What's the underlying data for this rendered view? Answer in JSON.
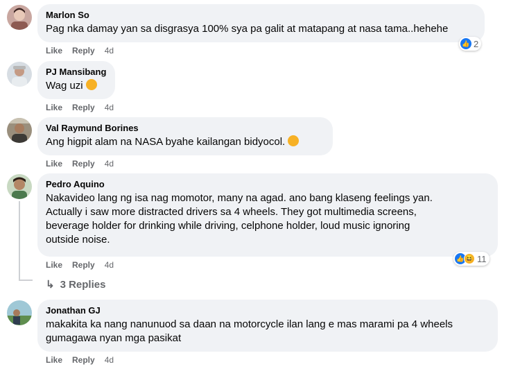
{
  "comments": [
    {
      "author": "Marlon So",
      "text": "Pag nka damay yan sa disgrasya 100% sya pa galit at matapang at nasa tama..hehehe",
      "like": "Like",
      "reply": "Reply",
      "time": "4d",
      "reaction_count": "2"
    },
    {
      "author": "PJ Mansibang",
      "text": "Wag uzi",
      "like": "Like",
      "reply": "Reply",
      "time": "4d"
    },
    {
      "author": "Val Raymund Borines",
      "text": "Ang higpit alam na NASA byahe kailangan bidyocol.",
      "like": "Like",
      "reply": "Reply",
      "time": "4d"
    },
    {
      "author": "Pedro Aquino",
      "lines": [
        "Nakavideo lang ng isa nag momotor, many na agad. ano bang klaseng feelings yan.",
        "Actually i saw more distracted drivers sa 4 wheels. They got multimedia screens,",
        "beverage holder for drinking while driving, celphone holder, loud music ignoring",
        "outside noise."
      ],
      "like": "Like",
      "reply": "Reply",
      "time": "4d",
      "reaction_count": "11",
      "replies_label": "3 Replies"
    },
    {
      "author": "Jonathan GJ",
      "lines": [
        "makakita ka nang nanunuod sa daan na motorcycle ilan lang e mas marami pa 4 wheels",
        "gumagawa nyan mga pasikat"
      ],
      "like": "Like",
      "reply": "Reply",
      "time": "4d"
    }
  ],
  "colors": {
    "bubble": "#f0f2f5",
    "secondary_text": "#65676b",
    "like_blue": "#1877f2",
    "haha_yellow": "#f7b125"
  }
}
